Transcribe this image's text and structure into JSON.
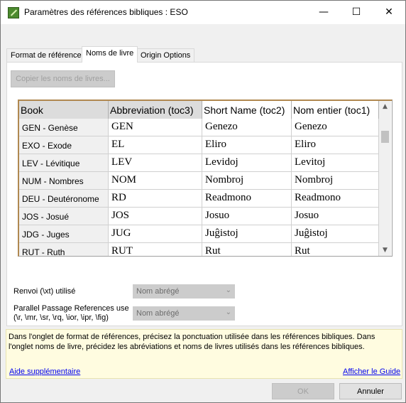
{
  "window": {
    "title": "Paramètres des références bibliques : ESO"
  },
  "controls": {
    "minimize": "—",
    "maximize": "☐",
    "close": "✕"
  },
  "tabs": [
    {
      "label": "Format de référence"
    },
    {
      "label": "Noms de livre"
    },
    {
      "label": "Origin Options"
    }
  ],
  "copy_button": "Copier les noms de livres...",
  "grid": {
    "headers": [
      "Book",
      "Abbreviation (toc3)",
      "Short Name (toc2)",
      "Nom entier (toc1)"
    ],
    "rows": [
      {
        "book": "GEN - Genèse",
        "abbr": "GEN",
        "short": "Genezo",
        "long": "Genezo"
      },
      {
        "book": "EXO - Exode",
        "abbr": "EL",
        "short": "Eliro",
        "long": "Eliro"
      },
      {
        "book": "LEV - Lévitique",
        "abbr": "LEV",
        "short": "Levidoj",
        "long": "Levitoj"
      },
      {
        "book": "NUM - Nombres",
        "abbr": "NOM",
        "short": "Nombroj",
        "long": "Nombroj"
      },
      {
        "book": "DEU - Deutéronome",
        "abbr": "RD",
        "short": "Readmono",
        "long": "Readmono"
      },
      {
        "book": "JOS - Josué",
        "abbr": "JOS",
        "short": "Josuo",
        "long": "Josuo"
      },
      {
        "book": "JDG - Juges",
        "abbr": "JUG",
        "short": "Juĝistoj",
        "long": "Juĝistoj"
      },
      {
        "book": "RUT - Ruth",
        "abbr": "RUT",
        "short": "Rut",
        "long": "Rut"
      }
    ]
  },
  "crossref": {
    "label": "Renvoi (\\xt) utilisé",
    "value": "Nom abrégé"
  },
  "parallel": {
    "label_line1": "Parallel Passage References use",
    "label_line2": "(\\r, \\mr, \\sr, \\rq, \\ior, \\ipr, \\fig)",
    "value": "Nom abrégé"
  },
  "help": {
    "text": "Dans l'onglet de format de références, précisez la ponctuation utilisée dans les références bibliques. Dans l'onglet noms de livre, précidez les abréviations et noms de livres utilisés dans les références bibliques.",
    "more_link": "Aide supplémentaire",
    "guide_link": "Afficher le Guide"
  },
  "ok": "OK",
  "cancel": "Annuler"
}
